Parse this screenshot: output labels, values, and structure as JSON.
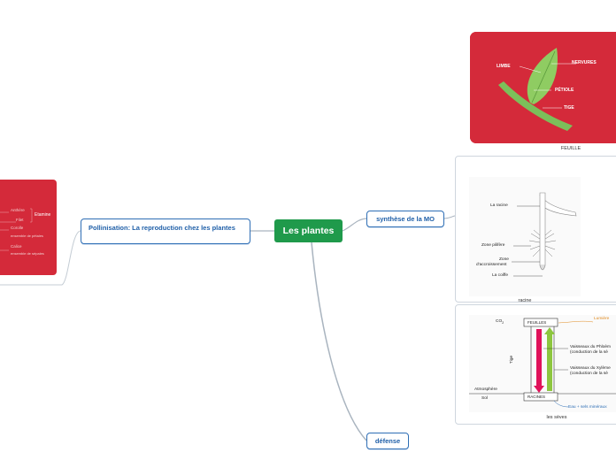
{
  "central": {
    "label": "Les plantes"
  },
  "topics": {
    "synthese": "synthèse de la MO",
    "defense": "défense",
    "pollinisation": "Pollinisation: La reproduction chez les plantes"
  },
  "leaf_image": {
    "caption": "FEUILLE",
    "labels": {
      "limbe": "LIMBE",
      "nervures": "NERVURES",
      "petiole": "PÉTIOLE",
      "tige": "TIGE"
    }
  },
  "root_image": {
    "caption": "racine",
    "labels": {
      "racine": "La racine",
      "zone_pilifere": "Zone pilifère",
      "zone_accroissement_1": "Zone",
      "zone_accroissement_2": "d'accroissement",
      "coiffe": "La coiffe"
    }
  },
  "sap_image": {
    "caption": "les sèves",
    "labels": {
      "co2": "CO",
      "co2_sub": "2",
      "feuilles": "FEUILLES",
      "racines": "RACINES",
      "lumiere": "Lumière",
      "phloeme_1": "Vaisseaux du Phloèm",
      "phloeme_2": "(conduction de la sè",
      "xyleme_1": "Vaisseaux du Xylème",
      "xyleme_2": "(conduction de la sè",
      "tige": "Tige",
      "atmosphere": "Atmosphère",
      "sol": "Sol",
      "eau": "Eau + sels minéraux"
    }
  },
  "flower_image": {
    "labels": {
      "anthere": "Anthère",
      "filet": "Filet",
      "etamine": "Etamine",
      "corolle": "Corolle",
      "corolle_desc": "ensemble de pétales",
      "calice": "Calice",
      "calice_desc": "ensemble de sépales"
    }
  },
  "colors": {
    "central": "#1f9a4b",
    "topic_border": "#2e6eb5",
    "red_card": "#d42a3a",
    "leaf_green": "#7cbf5a",
    "phloem": "#e0125a",
    "xylem": "#8dc63f"
  }
}
